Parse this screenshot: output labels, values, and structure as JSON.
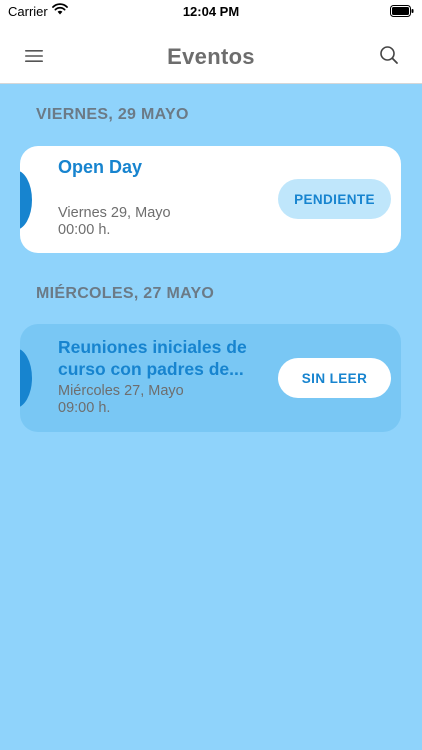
{
  "status_bar": {
    "carrier": "Carrier",
    "time": "12:04 PM"
  },
  "header": {
    "title": "Eventos"
  },
  "sections": [
    {
      "header": "VIERNES, 29 MAYO",
      "events": [
        {
          "title": "Open Day",
          "date": "Viernes 29, Mayo",
          "time": "00:00 h.",
          "status": "PENDIENTE"
        }
      ]
    },
    {
      "header": "MIÉRCOLES, 27 MAYO",
      "events": [
        {
          "title_line1": "Reuniones iniciales de",
          "title_line2": "curso con padres de...",
          "date": "Miércoles 27, Mayo",
          "time": "09:00 h.",
          "status": "SIN LEER"
        }
      ]
    }
  ],
  "colors": {
    "background": "#8fd3fb",
    "accent": "#1784cf",
    "card_read": "#ffffff",
    "card_unread": "#79c7f4",
    "pending_badge": "#bfe6fb"
  }
}
